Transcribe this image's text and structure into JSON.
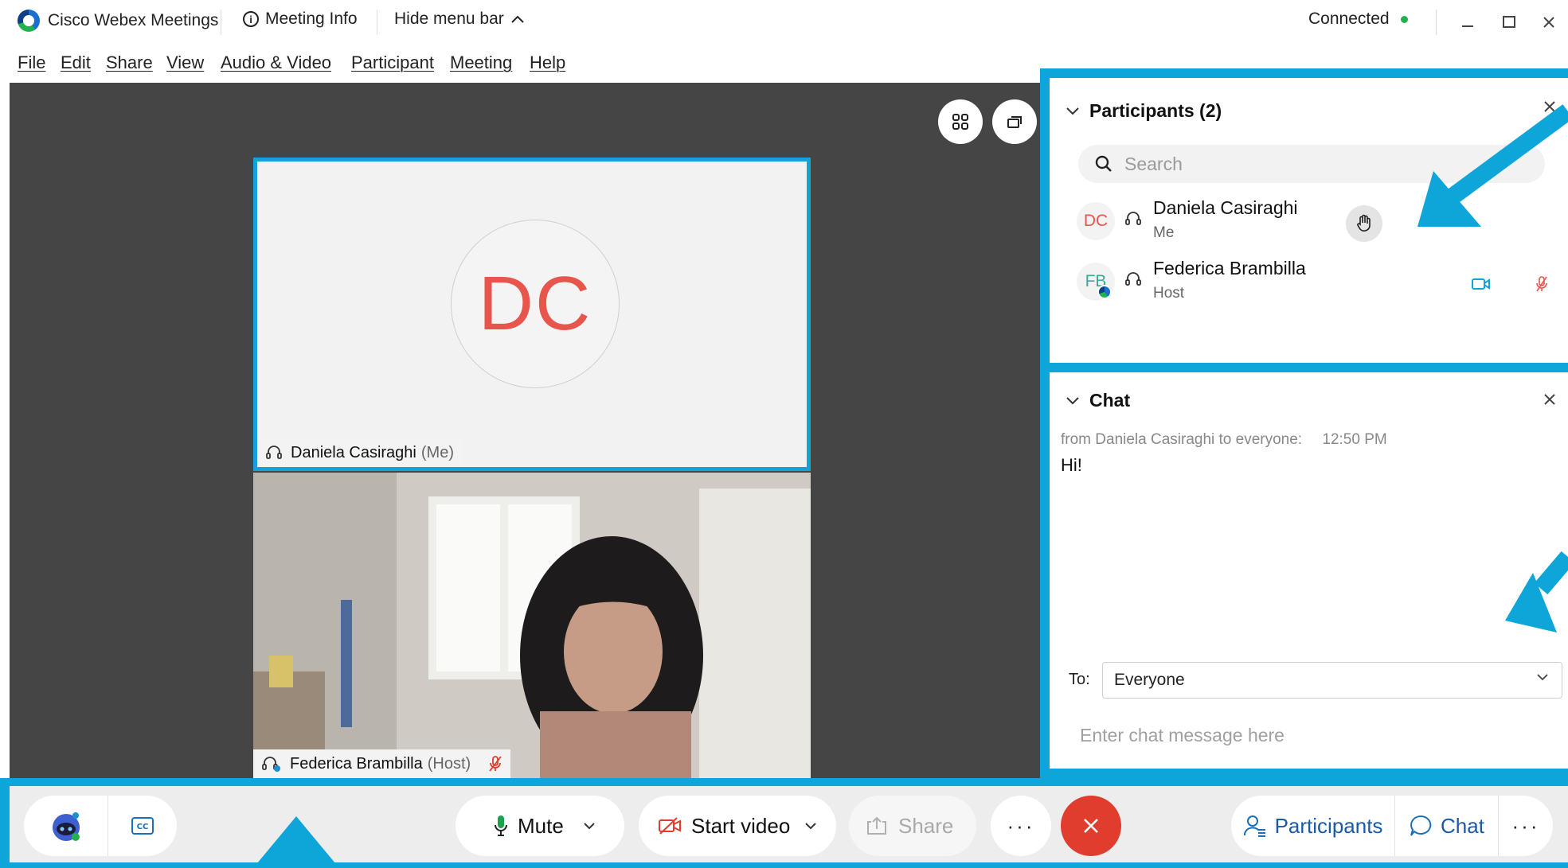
{
  "title_bar": {
    "app_name": "Cisco Webex Meetings",
    "meeting_info_label": "Meeting Info",
    "hide_menu_label": "Hide menu bar",
    "status": "Connected",
    "status_color": "#23b14d"
  },
  "menu": {
    "items": [
      "File",
      "Edit",
      "Share",
      "View",
      "Audio & Video",
      "Participant",
      "Meeting",
      "Help"
    ]
  },
  "stage": {
    "me_tile": {
      "initials": "DC",
      "name": "Daniela Casiraghi",
      "role": "(Me)"
    },
    "host_tile": {
      "name": "Federica Brambilla",
      "role": "(Host)"
    }
  },
  "participants_panel": {
    "title": "Participants (2)",
    "search_placeholder": "Search",
    "people": [
      {
        "initials": "DC",
        "name": "Daniela Casiraghi",
        "role": "Me",
        "initials_color": "#e8554d"
      },
      {
        "initials": "FB",
        "name": "Federica Brambilla",
        "role": "Host",
        "initials_color": "#3aa89a"
      }
    ]
  },
  "chat_panel": {
    "title": "Chat",
    "message_meta": "from Daniela Casiraghi to everyone:",
    "message_time": "12:50 PM",
    "message_text": "Hi!",
    "to_label": "To:",
    "to_value": "Everyone",
    "input_placeholder": "Enter chat message here"
  },
  "toolbar": {
    "mute_label": "Mute",
    "start_video_label": "Start video",
    "share_label": "Share",
    "participants_label": "Participants",
    "chat_label": "Chat",
    "more_label": "···"
  },
  "colors": {
    "highlight": "#0ea6d9",
    "end_call": "#e03d2e",
    "avatar_initials": "#e8554d"
  }
}
